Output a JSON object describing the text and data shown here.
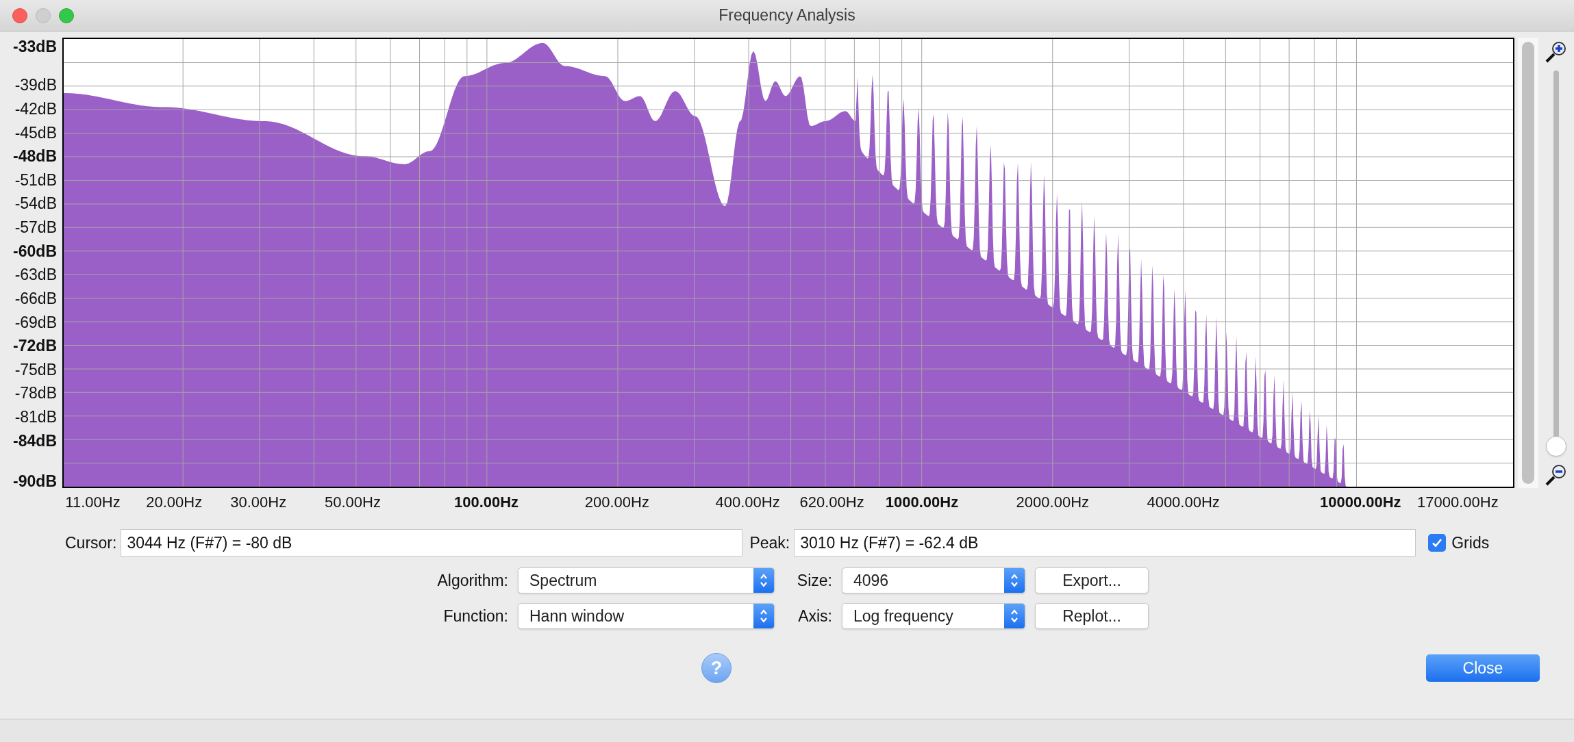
{
  "window": {
    "title": "Frequency Analysis"
  },
  "chart": {
    "y_labels": [
      {
        "text": "-33dB",
        "major": true
      },
      {
        "text": "-39dB",
        "major": false
      },
      {
        "text": "-42dB",
        "major": false
      },
      {
        "text": "-45dB",
        "major": false
      },
      {
        "text": "-48dB",
        "major": true
      },
      {
        "text": "-51dB",
        "major": false
      },
      {
        "text": "-54dB",
        "major": false
      },
      {
        "text": "-57dB",
        "major": false
      },
      {
        "text": "-60dB",
        "major": true
      },
      {
        "text": "-63dB",
        "major": false
      },
      {
        "text": "-66dB",
        "major": false
      },
      {
        "text": "-69dB",
        "major": false
      },
      {
        "text": "-72dB",
        "major": true
      },
      {
        "text": "-75dB",
        "major": false
      },
      {
        "text": "-78dB",
        "major": false
      },
      {
        "text": "-81dB",
        "major": false
      },
      {
        "text": "-84dB",
        "major": true
      },
      {
        "text": "-90dB",
        "major": true
      }
    ],
    "x_labels": [
      {
        "text": "11.00Hz",
        "major": false
      },
      {
        "text": "20.00Hz",
        "major": false
      },
      {
        "text": "30.00Hz",
        "major": false
      },
      {
        "text": "50.00Hz",
        "major": false
      },
      {
        "text": "100.00Hz",
        "major": true
      },
      {
        "text": "200.00Hz",
        "major": false
      },
      {
        "text": "400.00Hz",
        "major": false
      },
      {
        "text": "620.00Hz",
        "major": false
      },
      {
        "text": "1000.00Hz",
        "major": true
      },
      {
        "text": "2000.00Hz",
        "major": false
      },
      {
        "text": "4000.00Hz",
        "major": false
      },
      {
        "text": "10000.00Hz",
        "major": true
      },
      {
        "text": "17000.00Hz",
        "major": false
      }
    ],
    "zoom": {
      "level": 0
    }
  },
  "cursor": {
    "label": "Cursor:",
    "value": "3044 Hz (F#7) = -80 dB"
  },
  "peak": {
    "label": "Peak:",
    "value": "3010 Hz (F#7) = -62.4 dB"
  },
  "grids": {
    "label": "Grids",
    "checked": true
  },
  "settings": [
    {
      "label": "Algorithm:",
      "value": "Spectrum"
    },
    {
      "label": "Size:",
      "value": "4096"
    },
    {
      "label": "Function:",
      "value": "Hann window"
    },
    {
      "label": "Axis:",
      "value": "Log frequency"
    }
  ],
  "buttons": [
    "Export...",
    "Replot..."
  ],
  "help": "?",
  "close": "Close"
}
